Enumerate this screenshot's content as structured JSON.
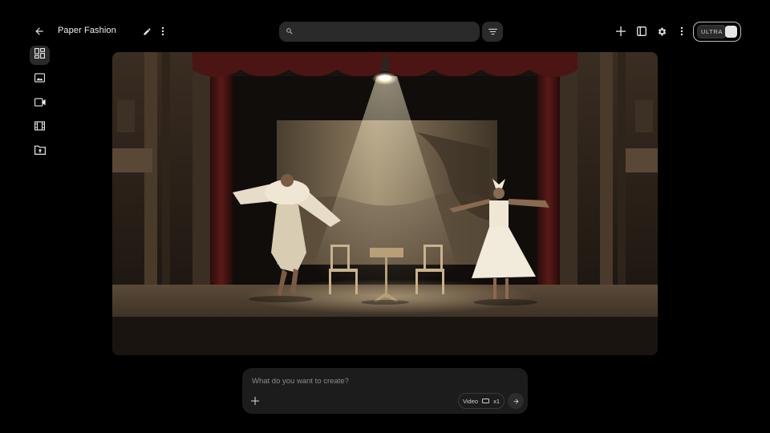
{
  "header": {
    "project_title": "Paper Fashion",
    "search": {
      "value": "",
      "placeholder": ""
    },
    "plan_label": "ULTRA"
  },
  "sidebar": {
    "items": [
      {
        "name": "dashboard",
        "icon": "dashboard-icon",
        "active": true
      },
      {
        "name": "images",
        "icon": "image-icon",
        "active": false
      },
      {
        "name": "videos",
        "icon": "video-camera-icon",
        "active": false
      },
      {
        "name": "film",
        "icon": "film-strip-icon",
        "active": false
      },
      {
        "name": "folder",
        "icon": "folder-upload-icon",
        "active": false
      }
    ]
  },
  "composer": {
    "placeholder": "What do you want to create?",
    "value": "",
    "mode_label": "Video",
    "count_label": "x1"
  },
  "colors": {
    "background": "#000000",
    "surface": "#2a2a2a",
    "composer": "#1c1c1c",
    "text": "#f0f0f0"
  }
}
